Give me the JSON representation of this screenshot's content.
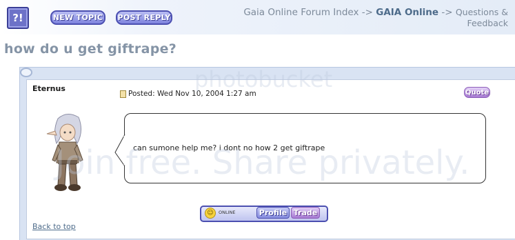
{
  "header": {
    "help_label": "?!",
    "new_topic_label": "NEW TOPIC",
    "post_reply_label": "POST REPLY",
    "breadcrumb": {
      "forum_index": "Gaia Online Forum Index",
      "sep1": "->",
      "section": "GAIA Online",
      "sep2": "->",
      "subforum": "Questions & Feedback"
    }
  },
  "thread": {
    "title": "how do u get giftrape?"
  },
  "post": {
    "username": "Eternus",
    "posted": "Posted: Wed Nov 10, 2004 1:27 am",
    "quote_label": "Quote",
    "message": "can sumone help me? i dont no how 2 get giftrape",
    "status": "ONLINE",
    "profile_label": "Profile",
    "trade_label": "Trade",
    "back_to_top": "Back to top"
  },
  "watermark": {
    "line1": "photobucket",
    "line2": "Join free. Share privately."
  },
  "colors": {
    "accent_purple": "#6d72c8",
    "link_blue": "#4d6b8a",
    "title_grey": "#8594a6",
    "post_frame": "#d9e3f3"
  }
}
